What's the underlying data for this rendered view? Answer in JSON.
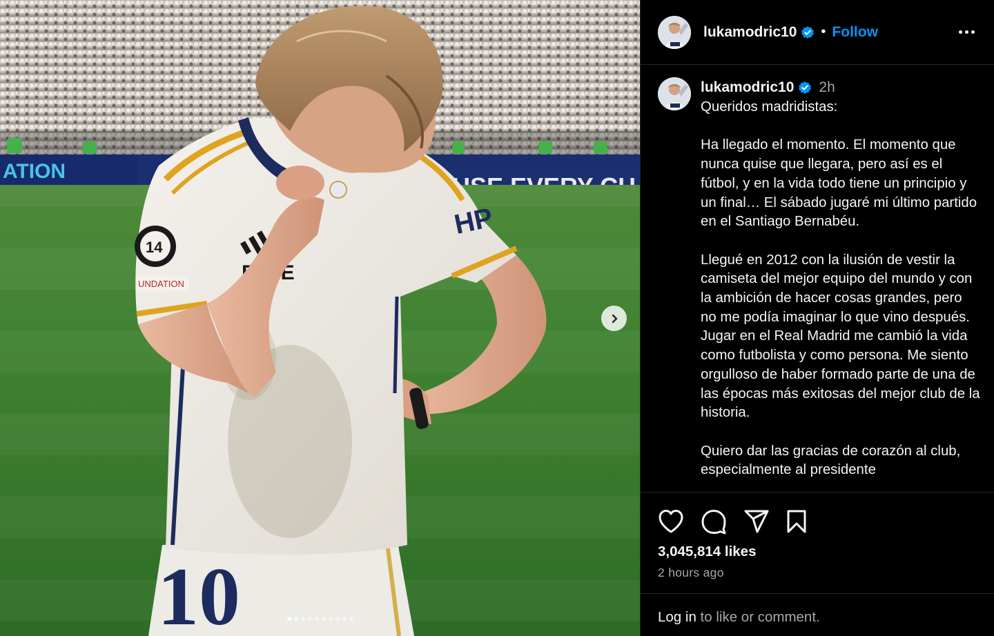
{
  "header": {
    "username": "lukamodric10",
    "separator": "•",
    "follow_label": "Follow",
    "more_icon": "more-horizontal-icon"
  },
  "media": {
    "total_slides": 10,
    "active_slide": 1,
    "next_icon": "chevron-right-icon",
    "photo_text": {
      "board_left": "ATION",
      "board_right": "USE EVERY CH",
      "shirt_number": "10",
      "ucl_badge": "14",
      "sleeve_patch": "UNDATION"
    }
  },
  "caption": {
    "username": "lukamodric10",
    "time": "2h",
    "text": "Queridos madridistas:\n\nHa llegado el momento. El momento que nunca quise que llegara, pero así es el fútbol, y en la vida todo tiene un principio y un final… El sábado jugaré mi último partido en el Santiago Bernabéu.\n\nLlegué en 2012 con la ilusión de vestir la camiseta del mejor equipo del mundo y con la ambición de hacer cosas grandes, pero no me podía imaginar lo que vino después.\nJugar en el Real Madrid me cambió la vida como futbolista y como persona. Me siento orgulloso de haber formado parte de una de las épocas más exitosas del mejor club de la historia.\n\nQuiero dar las gracias de corazón al club, especialmente al presidente"
  },
  "actions": {
    "like_icon": "heart-icon",
    "comment_icon": "comment-icon",
    "share_icon": "send-icon",
    "save_icon": "bookmark-icon"
  },
  "stats": {
    "likes": "3,045,814 likes",
    "posted": "2 hours ago"
  },
  "footer": {
    "login_link": "Log in",
    "login_rest": " to like or comment."
  },
  "colors": {
    "background": "#000000",
    "accent": "#0095f6",
    "muted": "#a8a8a8",
    "divider": "#262626"
  }
}
